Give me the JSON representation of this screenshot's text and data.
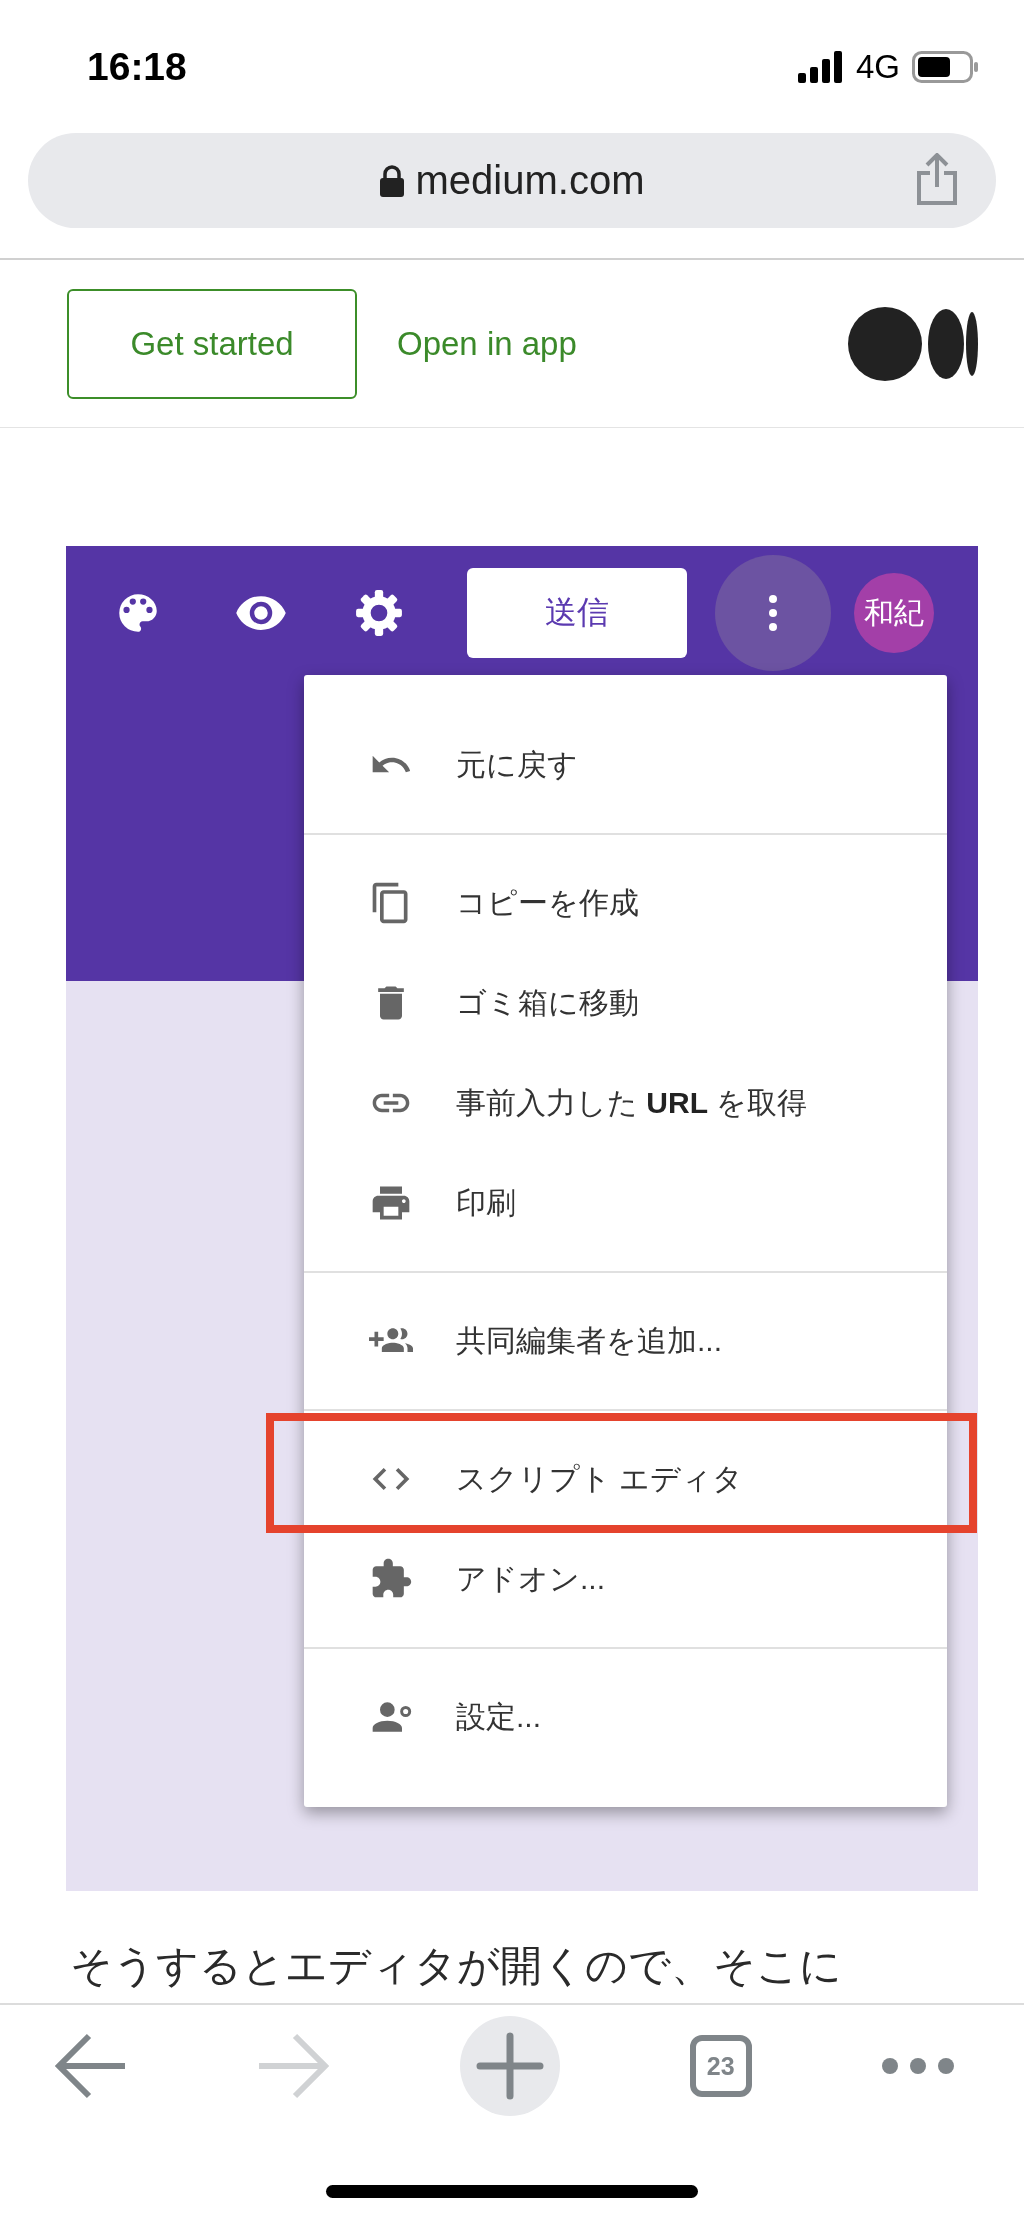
{
  "status_bar": {
    "time": "16:18",
    "network": "4G"
  },
  "address_bar": {
    "url": "medium.com"
  },
  "site_header": {
    "get_started": "Get started",
    "open_in_app": "Open in app"
  },
  "embedded_screenshot": {
    "send_button": "送信",
    "avatar": "和紀",
    "menu_groups": [
      [
        {
          "kind": "undo",
          "label": "元に戻す",
          "highlighted": false
        }
      ],
      [
        {
          "kind": "copy",
          "label": "コピーを作成",
          "highlighted": false
        },
        {
          "kind": "trash",
          "label": "ゴミ箱に移動",
          "highlighted": false
        },
        {
          "kind": "link",
          "label": "事前入力した **URL** を取得",
          "highlighted": false
        },
        {
          "kind": "print",
          "label": "印刷",
          "highlighted": false
        }
      ],
      [
        {
          "kind": "collaborators",
          "label": "共同編集者を追加...",
          "highlighted": false
        }
      ],
      [
        {
          "kind": "script",
          "label": "スクリプト エディタ",
          "highlighted": true
        },
        {
          "kind": "addon",
          "label": "アドオン...",
          "highlighted": false
        }
      ],
      [
        {
          "kind": "preferences",
          "label": "設定...",
          "highlighted": false
        }
      ]
    ]
  },
  "article": {
    "paragraph": "そうするとエディタが開くので、そこに"
  },
  "browser_toolbar": {
    "forward_disabled": true,
    "tab_count": "23"
  }
}
